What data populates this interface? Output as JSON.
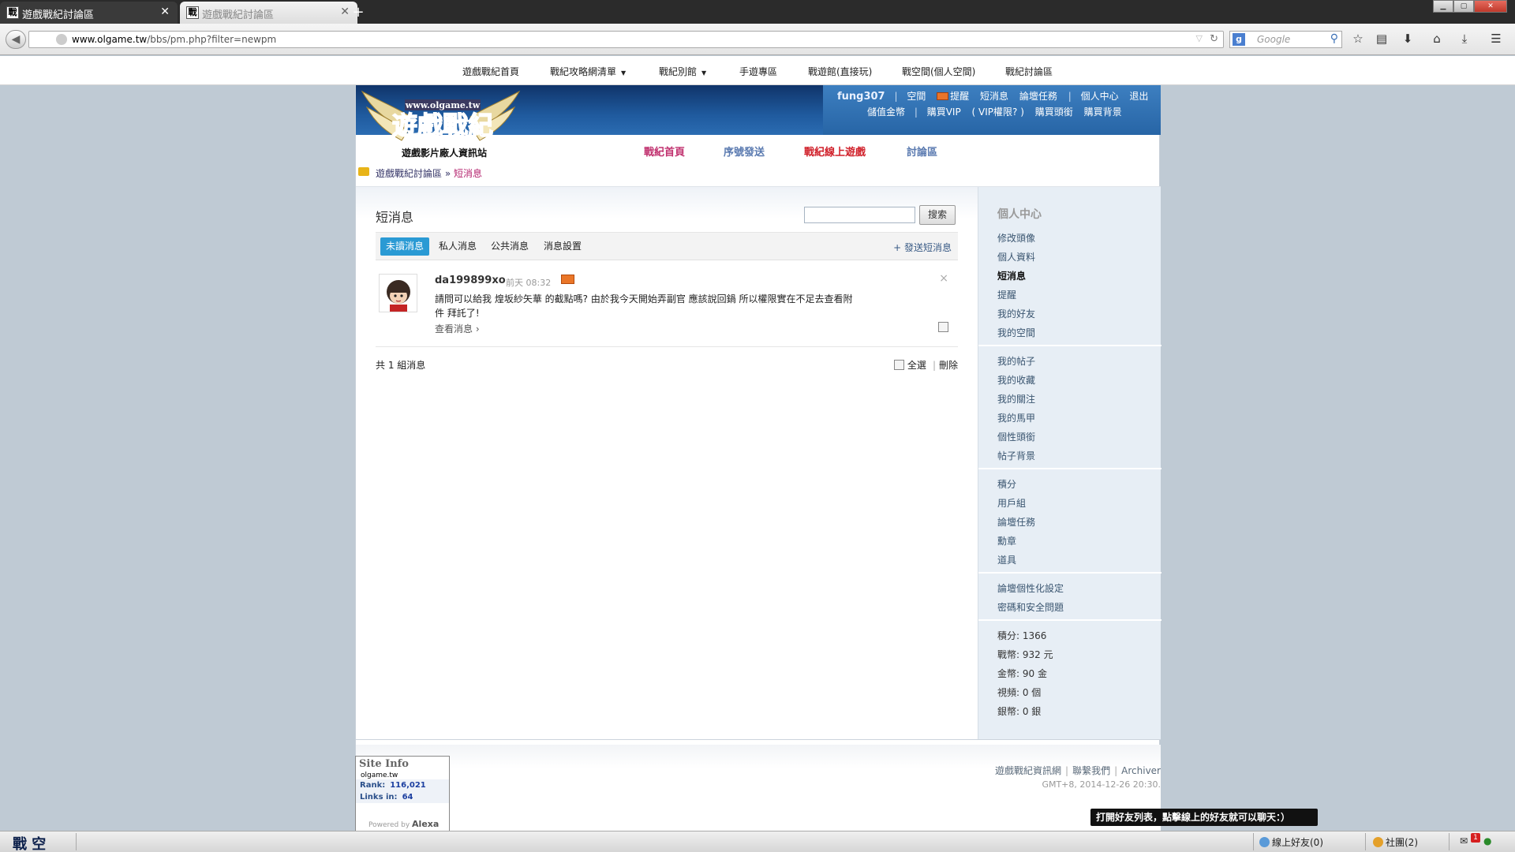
{
  "browser": {
    "tabs": [
      {
        "title": "遊戲戰紀討論區",
        "favicon": "戰",
        "active": true
      },
      {
        "title": "遊戲戰紀討論區",
        "favicon": "戰",
        "active": false
      }
    ],
    "url_host": "www.olgame.tw",
    "url_path": "/bbs/pm.php?filter=newpm",
    "search_placeholder": "Google"
  },
  "site_nav": {
    "items": [
      "遊戲戰紀首頁",
      "戰紀攻略網清單",
      "戰紀別館",
      "手遊專區",
      "戰遊館(直接玩)",
      "戰空間(個人空間)",
      "戰紀討論區"
    ]
  },
  "logo": {
    "url_text": "www.olgame.tw",
    "main": "遊戲戰紀",
    "sub": "遊戲影片廠人資訊站"
  },
  "user": {
    "name": "fung307",
    "row1": [
      "空間",
      "提醒",
      "短消息",
      "論壇任務",
      "個人中心",
      "退出"
    ],
    "row2": [
      "儲值金幣",
      "購買VIP",
      "( VIP權限? )",
      "購買頭銜",
      "購買背景"
    ]
  },
  "main_nav": {
    "items": [
      {
        "label": "戰紀首頁",
        "color": "#c0306e"
      },
      {
        "label": "序號發送",
        "color": "#5a7ab0"
      },
      {
        "label": "戰紀線上遊戲",
        "color": "#d0202a"
      },
      {
        "label": "討論區",
        "color": "#5a7ab0"
      }
    ]
  },
  "breadcrumb": {
    "root": "遊戲戰紀討論區",
    "sep": "»",
    "current": "短消息"
  },
  "pm": {
    "title": "短消息",
    "search_button": "搜索",
    "tabs": [
      "未讀消息",
      "私人消息",
      "公共消息",
      "消息設置"
    ],
    "send": "+ 發送短消息",
    "messages": [
      {
        "sender": "da199899xo",
        "time": "前天 08:32",
        "body": "請問可以給我 煌坂紗矢華 的截點嗎? 由於我今天開始弄副官 應該說回鍋 所以權限實在不足去查看附件 拜託了!",
        "view": "查看消息 ›",
        "delete": "×"
      }
    ],
    "total": "共 1 組消息",
    "select_all": "全選",
    "delete_label": "刪除"
  },
  "sidebar": {
    "title": "個人中心",
    "group1": [
      "修改頭像",
      "個人資料",
      "短消息",
      "提醒",
      "我的好友",
      "我的空間"
    ],
    "current": "短消息",
    "group2": [
      "我的帖子",
      "我的收藏",
      "我的關注",
      "我的馬甲",
      "個性頭銜",
      "帖子背景"
    ],
    "group3": [
      "積分",
      "用戶組",
      "論壇任務",
      "勳章",
      "道具"
    ],
    "group4": [
      "論壇個性化設定",
      "密碼和安全問題"
    ],
    "stats": [
      "積分: 1366",
      "戰幣: 932 元",
      "金幣: 90 金",
      "視頻: 0 個",
      "銀幣: 0 銀"
    ]
  },
  "footer": {
    "links": [
      "遊戲戰紀資訊網",
      "聯繫我們",
      "Archiver"
    ],
    "gmt": "GMT+8, 2014-12-26 20:30."
  },
  "siteinfo": {
    "head": "Site Info",
    "domain": "olgame.tw",
    "rank_label": "Rank:",
    "rank": "116,021",
    "links_label": "Links in:",
    "links": "64",
    "powered": "Powered by",
    "brand": "Alexa"
  },
  "tooltip": "打開好友列表，點擊線上的好友就可以聊天：）",
  "statusbar": {
    "logo": "戰 空",
    "friends": "線上好友(0)",
    "groups": "社團(2)",
    "badge": "1"
  }
}
